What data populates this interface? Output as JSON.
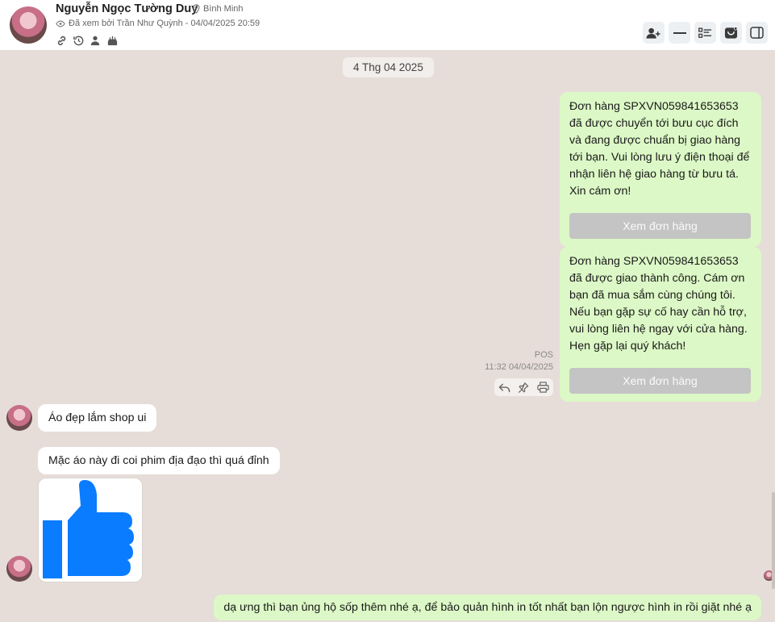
{
  "header": {
    "contact_name": "Nguyễn Ngọc Tường Duy",
    "location": "Bình Minh",
    "seen_by": "Đã xem bởi Trần Như Quỳnh - 04/04/2025 20:59",
    "meta_icons": [
      "link-icon",
      "history-icon",
      "person-icon",
      "cake-icon"
    ],
    "tools": [
      "add-user-icon",
      "minus-icon",
      "list-icon",
      "inbox-icon",
      "sidebar-panel-icon"
    ]
  },
  "conversation": {
    "date_chip": "4 Thg 04 2025",
    "messages": [
      {
        "direction": "out",
        "text": "Đơn hàng SPXVN059841653653 đã được chuyển tới bưu cục đích và đang được chuẩn bị giao hàng tới bạn. Vui lòng lưu ý điện thoại để nhận liên hệ giao hàng từ bưu tá. Xin cám ơn!",
        "button": "Xem đơn hàng"
      },
      {
        "direction": "out",
        "text": "Đơn hàng SPXVN059841653653 đã được giao thành công. Cám ơn bạn đã mua sắm cùng chúng tôi. Nếu bạn gặp sự cố hay cần hỗ trợ, vui lòng liên hệ ngay với cửa hàng. Hẹn gặp lại quý khách!",
        "button": "Xem đơn hàng",
        "sender": "POS",
        "time": "11:32 04/04/2025",
        "actions": [
          "reply-icon",
          "pin-icon",
          "print-icon"
        ]
      },
      {
        "direction": "in",
        "text": "Áo đẹp lắm shop ui"
      },
      {
        "direction": "in",
        "text": "Mặc áo này đi coi phim địa đạo thì quá đỉnh"
      },
      {
        "direction": "in",
        "sticker": "thumbs-up-icon",
        "sticker_color": "#0a7cff"
      },
      {
        "direction": "out",
        "text": "dạ ưng thì bạn ủng hộ sốp thêm nhé ạ, để bảo quản hình in tốt nhất bạn lộn ngược hình in rồi giặt nhé ạ"
      }
    ]
  },
  "colors": {
    "chat_background": "#e6ddd8",
    "outgoing_bubble": "#dcf8c6",
    "incoming_bubble": "#ffffff",
    "disabled_button": "#c4c4c4",
    "thumbs_up": "#0a7cff"
  }
}
